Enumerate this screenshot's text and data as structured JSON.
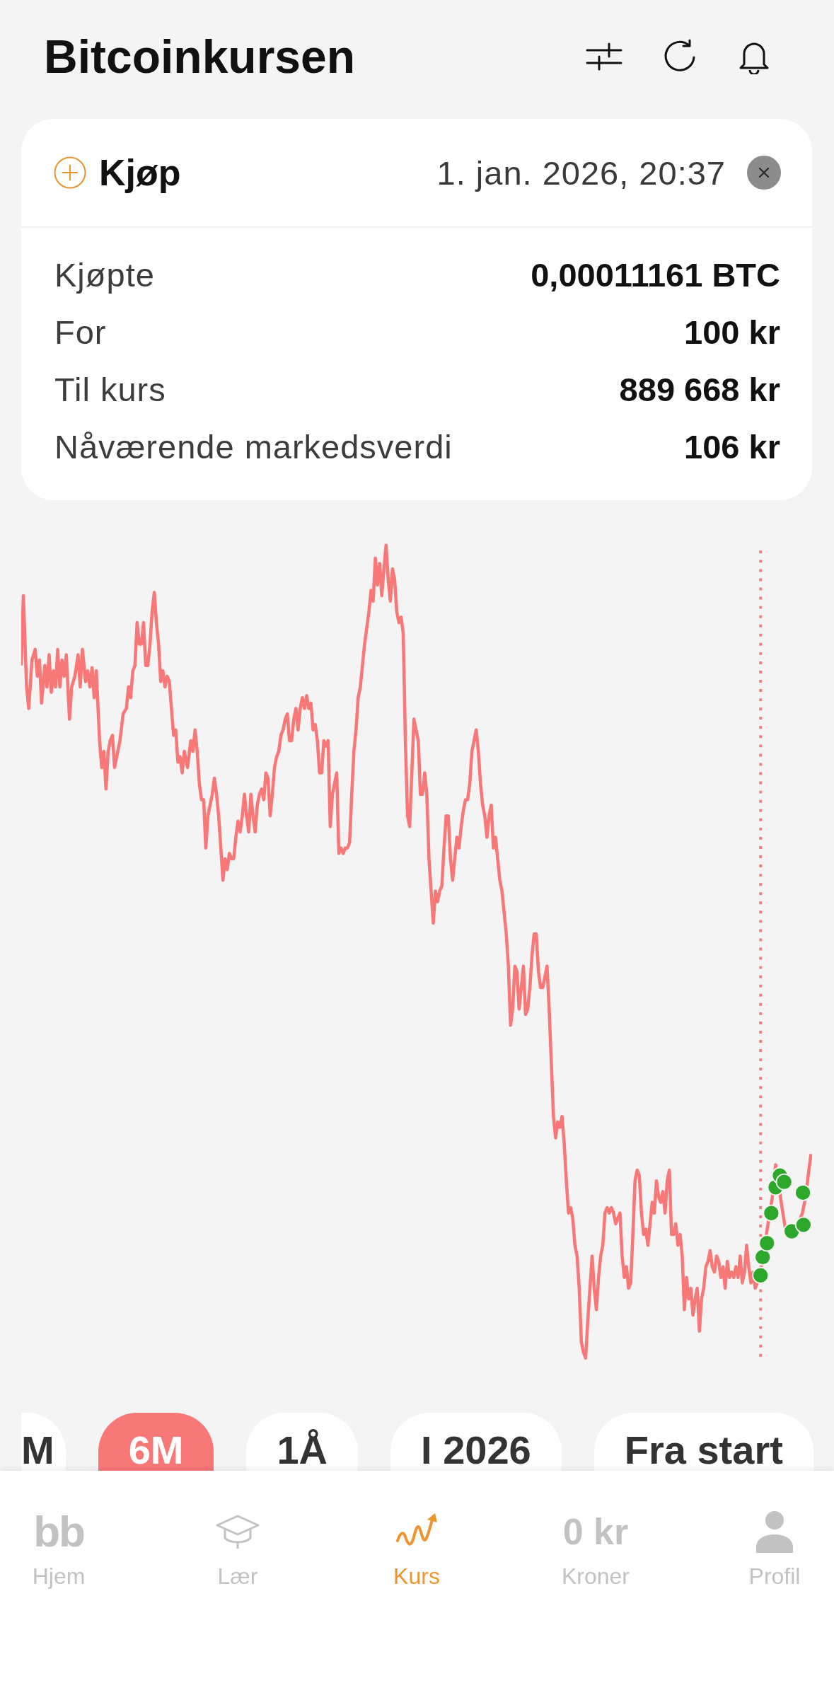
{
  "header": {
    "title": "Bitcoinkursen"
  },
  "purchase_card": {
    "type_label": "Kjøp",
    "date": "1. jan. 2026, 20:37",
    "rows": [
      {
        "label": "Kjøpte",
        "value": "0,00011161 BTC"
      },
      {
        "label": "For",
        "value": "100 kr"
      },
      {
        "label": "Til kurs",
        "value": "889 668 kr"
      },
      {
        "label": "Nåværende markedsverdi",
        "value": "106 kr"
      }
    ]
  },
  "periods": [
    {
      "label": "M",
      "selected": false
    },
    {
      "label": "6M",
      "selected": true
    },
    {
      "label": "1Å",
      "selected": false
    },
    {
      "label": "I 2026",
      "selected": false
    },
    {
      "label": "Fra start",
      "selected": false
    }
  ],
  "bottom_nav": [
    {
      "kind": "text",
      "icon_text": "bb",
      "label": "Hjem",
      "selected": false
    },
    {
      "kind": "icon",
      "label": "Lær",
      "selected": false
    },
    {
      "kind": "icon",
      "label": "Kurs",
      "selected": true
    },
    {
      "kind": "text",
      "icon_text": "0 kr",
      "label": "Kroner",
      "selected": false
    },
    {
      "kind": "icon",
      "label": "Profil",
      "selected": false
    }
  ]
}
